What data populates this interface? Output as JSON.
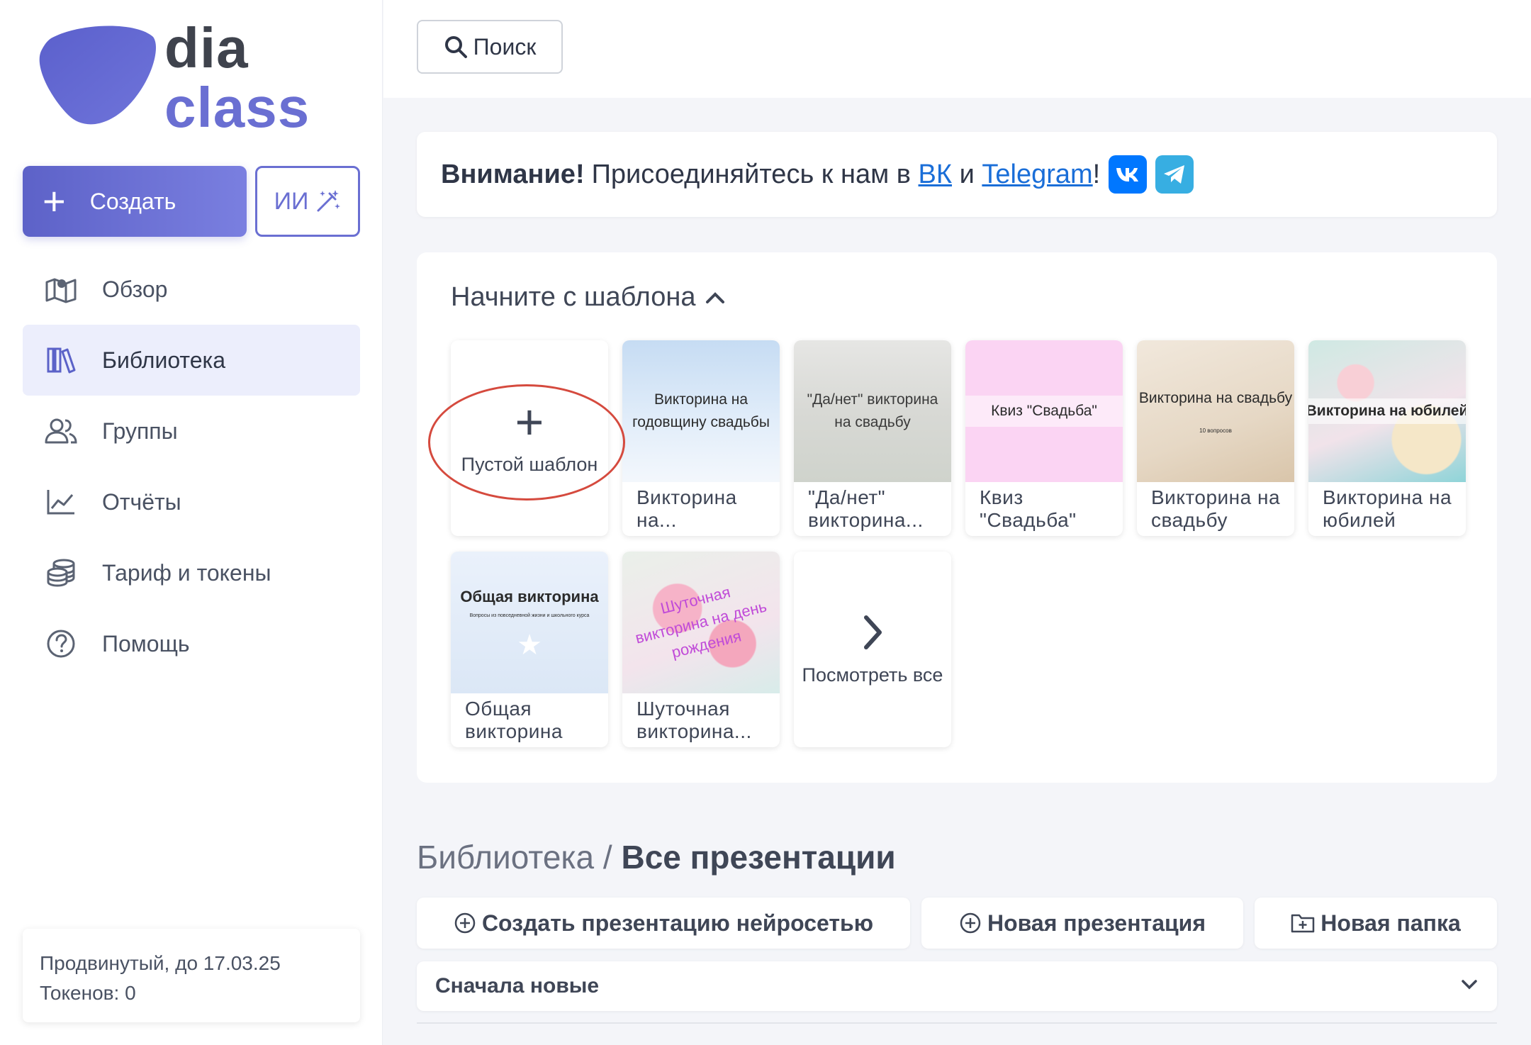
{
  "logo": {
    "line1": "dia",
    "line2": "class",
    "accent": "#6a6fd2"
  },
  "sidebar": {
    "create_label": "Создать",
    "ai_label": "ИИ",
    "nav": [
      {
        "label": "Обзор",
        "icon": "map-icon"
      },
      {
        "label": "Библиотека",
        "icon": "library-icon",
        "active": true
      },
      {
        "label": "Группы",
        "icon": "users-icon"
      },
      {
        "label": "Отчёты",
        "icon": "chart-line-icon"
      },
      {
        "label": "Тариф и токены",
        "icon": "coins-icon"
      },
      {
        "label": "Помощь",
        "icon": "help-icon"
      }
    ],
    "plan": {
      "line1": "Продвинутый, до 17.03.25",
      "line2": "Токенов: 0"
    }
  },
  "topbar": {
    "search_label": "Поиск"
  },
  "notice": {
    "bold": "Внимание!",
    "text1": "Присоединяйтесь к нам в",
    "link_vk": "ВК",
    "text2": "и",
    "link_tg": "Telegram",
    "text3": "!"
  },
  "templates": {
    "title": "Начните с шаблона",
    "empty_label": "Пустой шаблон",
    "see_all": "Посмотреть все",
    "items": [
      {
        "thumb": "Викторина на годовщину свадьбы",
        "caption": "Викторина на..."
      },
      {
        "thumb": "\"Да/нет\" викторина на свадьбу",
        "caption": "\"Да/нет\" викторина..."
      },
      {
        "thumb": "Квиз \"Свадьба\"",
        "caption": "Квиз \"Свадьба\""
      },
      {
        "thumb": "Викторина на свадьбу",
        "thumb_small": "10 вопросов",
        "caption": "Викторина на свадьбу"
      },
      {
        "thumb": "Викторина на юбилей",
        "caption": "Викторина на юбилей"
      },
      {
        "thumb": "Общая викторина",
        "thumb_small": "Вопросы из повседневной жизни и школьного курса",
        "caption": "Общая викторина"
      },
      {
        "thumb": "Шуточная викторина на день рождения",
        "caption": "Шуточная викторина..."
      }
    ]
  },
  "library": {
    "crumb": "Библиотека",
    "current": "Все презентации",
    "actions": {
      "ai": "Создать презентацию нейросетью",
      "new_pres": "Новая презентация",
      "new_folder": "Новая папка"
    },
    "sort": "Сначала новые"
  }
}
